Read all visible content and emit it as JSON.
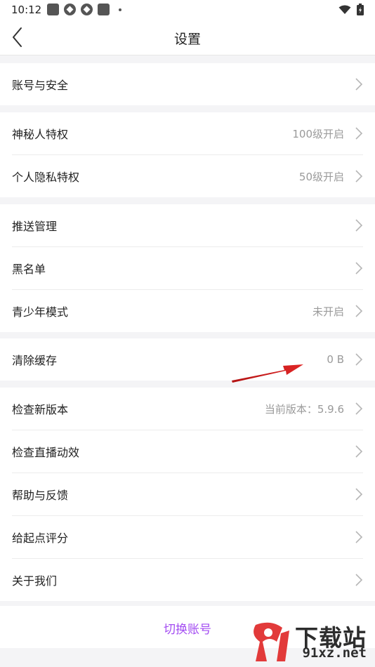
{
  "status_bar": {
    "time": "10:12"
  },
  "nav": {
    "title": "设置"
  },
  "groups": [
    {
      "items": [
        {
          "label": "账号与安全",
          "value": ""
        }
      ]
    },
    {
      "items": [
        {
          "label": "神秘人特权",
          "value": "100级开启"
        },
        {
          "label": "个人隐私特权",
          "value": "50级开启"
        }
      ]
    },
    {
      "items": [
        {
          "label": "推送管理",
          "value": ""
        },
        {
          "label": "黑名单",
          "value": ""
        },
        {
          "label": "青少年模式",
          "value": "未开启"
        }
      ]
    },
    {
      "items": [
        {
          "label": "清除缓存",
          "value": "0 B"
        }
      ]
    },
    {
      "items": [
        {
          "label": "检查新版本",
          "value": "当前版本：5.9.6"
        },
        {
          "label": "检查直播动效",
          "value": ""
        },
        {
          "label": "帮助与反馈",
          "value": ""
        },
        {
          "label": "给起点评分",
          "value": ""
        },
        {
          "label": "关于我们",
          "value": ""
        }
      ]
    }
  ],
  "switch_account": {
    "label": "切换账号"
  },
  "watermark": {
    "brand": "下载站",
    "url": "91xz.net"
  },
  "colors": {
    "accent": "#a34cf2",
    "annotation_arrow": "#d11f1f",
    "background": "#f4f4f6"
  },
  "icons": {
    "back": "chevron-left-icon",
    "row_arrow": "chevron-right-icon",
    "wifi": "wifi-icon",
    "battery": "battery-icon"
  }
}
